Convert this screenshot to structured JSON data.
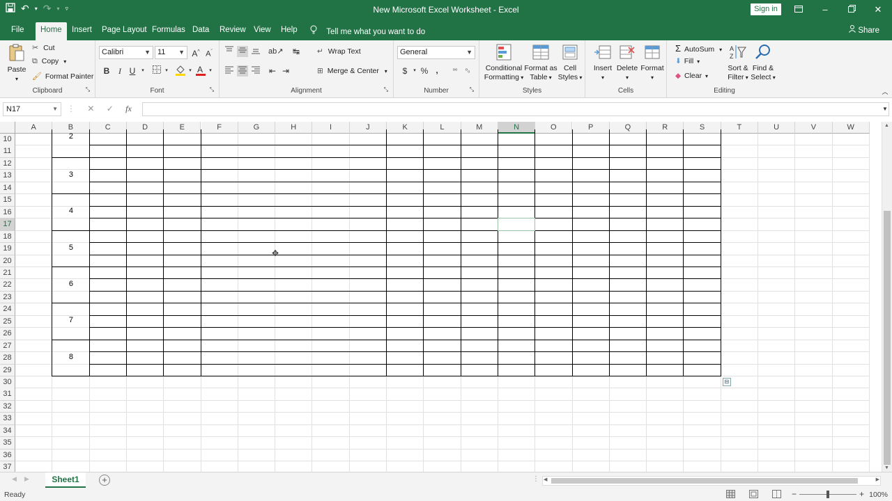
{
  "window": {
    "title": "New Microsoft Excel Worksheet - Excel",
    "signin": "Sign in",
    "qat": [
      "save-icon",
      "undo-icon",
      "redo-icon",
      "customize-icon"
    ],
    "controls": [
      "ribbon-display-icon",
      "minimize-icon",
      "restore-icon",
      "close-icon"
    ]
  },
  "tabs": [
    "File",
    "Home",
    "Insert",
    "Page Layout",
    "Formulas",
    "Data",
    "Review",
    "View",
    "Help"
  ],
  "active_tab": "Home",
  "tell_me": "Tell me what you want to do",
  "share": "Share",
  "ribbon": {
    "clipboard": {
      "label": "Clipboard",
      "paste": "Paste",
      "cut": "Cut",
      "copy": "Copy",
      "format_painter": "Format Painter"
    },
    "font": {
      "label": "Font",
      "name": "Calibri",
      "size": "11",
      "bold": "B",
      "italic": "I",
      "underline": "U"
    },
    "alignment": {
      "label": "Alignment",
      "wrap": "Wrap Text",
      "merge": "Merge & Center"
    },
    "number": {
      "label": "Number",
      "format": "General",
      "currency": "$",
      "percent": "%",
      "comma": ","
    },
    "styles": {
      "label": "Styles",
      "conditional_1": "Conditional",
      "conditional_2": "Formatting",
      "table_1": "Format as",
      "table_2": "Table",
      "cell_1": "Cell",
      "cell_2": "Styles"
    },
    "cells": {
      "label": "Cells",
      "insert": "Insert",
      "delete": "Delete",
      "format": "Format"
    },
    "editing": {
      "label": "Editing",
      "autosum": "AutoSum",
      "fill": "Fill",
      "clear": "Clear",
      "sort_1": "Sort &",
      "sort_2": "Filter",
      "find_1": "Find &",
      "find_2": "Select"
    }
  },
  "formula_bar": {
    "name_box": "N17",
    "fx": "fx",
    "value": ""
  },
  "grid": {
    "columns": [
      "A",
      "B",
      "C",
      "D",
      "E",
      "F",
      "G",
      "H",
      "I",
      "J",
      "K",
      "L",
      "M",
      "N",
      "O",
      "P",
      "Q",
      "R",
      "S",
      "T",
      "U",
      "V",
      "W"
    ],
    "rows": [
      "10",
      "11",
      "12",
      "13",
      "14",
      "15",
      "16",
      "17",
      "18",
      "19",
      "20",
      "21",
      "22",
      "23",
      "24",
      "25",
      "26",
      "27",
      "28",
      "29",
      "30",
      "31",
      "32",
      "33",
      "34",
      "35",
      "36",
      "37"
    ],
    "selected_column": "N",
    "selected_row": "17",
    "group_numbers": [
      "2",
      "3",
      "4",
      "5",
      "6",
      "7",
      "8"
    ]
  },
  "sheet_tabs": [
    "Sheet1"
  ],
  "status": {
    "ready": "Ready",
    "zoom": "100%"
  }
}
